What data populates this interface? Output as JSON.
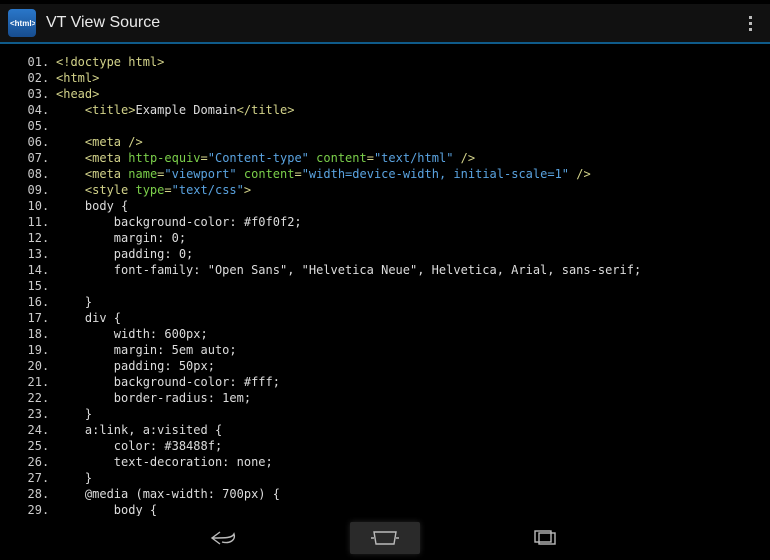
{
  "app": {
    "title": "VT View Source",
    "iconText": "<html>"
  },
  "source": {
    "lines": [
      {
        "n": "01",
        "tokens": [
          {
            "c": "tag",
            "t": "<!doctype html>"
          }
        ]
      },
      {
        "n": "02",
        "tokens": [
          {
            "c": "tag",
            "t": "<html>"
          }
        ]
      },
      {
        "n": "03",
        "tokens": [
          {
            "c": "tag",
            "t": "<head>"
          }
        ]
      },
      {
        "n": "04",
        "tokens": [
          {
            "c": "plain",
            "t": "    "
          },
          {
            "c": "tag",
            "t": "<title>"
          },
          {
            "c": "txt",
            "t": "Example Domain"
          },
          {
            "c": "tag",
            "t": "</title>"
          }
        ]
      },
      {
        "n": "05",
        "tokens": []
      },
      {
        "n": "06",
        "tokens": [
          {
            "c": "plain",
            "t": "    "
          },
          {
            "c": "tag",
            "t": "<meta />"
          }
        ]
      },
      {
        "n": "07",
        "tokens": [
          {
            "c": "plain",
            "t": "    "
          },
          {
            "c": "tag",
            "t": "<meta "
          },
          {
            "c": "attr",
            "t": "http-equiv"
          },
          {
            "c": "tag",
            "t": "="
          },
          {
            "c": "str",
            "t": "\"Content-type\""
          },
          {
            "c": "tag",
            "t": " "
          },
          {
            "c": "attr",
            "t": "content"
          },
          {
            "c": "tag",
            "t": "="
          },
          {
            "c": "str",
            "t": "\"text/html\""
          },
          {
            "c": "tag",
            "t": " />"
          }
        ]
      },
      {
        "n": "08",
        "tokens": [
          {
            "c": "plain",
            "t": "    "
          },
          {
            "c": "tag",
            "t": "<meta "
          },
          {
            "c": "attr",
            "t": "name"
          },
          {
            "c": "tag",
            "t": "="
          },
          {
            "c": "str",
            "t": "\"viewport\""
          },
          {
            "c": "tag",
            "t": " "
          },
          {
            "c": "attr",
            "t": "content"
          },
          {
            "c": "tag",
            "t": "="
          },
          {
            "c": "str",
            "t": "\"width=device-width, initial-scale=1\""
          },
          {
            "c": "tag",
            "t": " />"
          }
        ]
      },
      {
        "n": "09",
        "tokens": [
          {
            "c": "plain",
            "t": "    "
          },
          {
            "c": "tag",
            "t": "<style "
          },
          {
            "c": "attr",
            "t": "type"
          },
          {
            "c": "tag",
            "t": "="
          },
          {
            "c": "str",
            "t": "\"text/css\""
          },
          {
            "c": "tag",
            "t": ">"
          }
        ]
      },
      {
        "n": "10",
        "tokens": [
          {
            "c": "plain",
            "t": "    body {"
          }
        ]
      },
      {
        "n": "11",
        "tokens": [
          {
            "c": "plain",
            "t": "        background-color: #f0f0f2;"
          }
        ]
      },
      {
        "n": "12",
        "tokens": [
          {
            "c": "plain",
            "t": "        margin: 0;"
          }
        ]
      },
      {
        "n": "13",
        "tokens": [
          {
            "c": "plain",
            "t": "        padding: 0;"
          }
        ]
      },
      {
        "n": "14",
        "tokens": [
          {
            "c": "plain",
            "t": "        font-family: \"Open Sans\", \"Helvetica Neue\", Helvetica, Arial, sans-serif;"
          }
        ]
      },
      {
        "n": "15",
        "tokens": []
      },
      {
        "n": "16",
        "tokens": [
          {
            "c": "plain",
            "t": "    }"
          }
        ]
      },
      {
        "n": "17",
        "tokens": [
          {
            "c": "plain",
            "t": "    div {"
          }
        ]
      },
      {
        "n": "18",
        "tokens": [
          {
            "c": "plain",
            "t": "        width: 600px;"
          }
        ]
      },
      {
        "n": "19",
        "tokens": [
          {
            "c": "plain",
            "t": "        margin: 5em auto;"
          }
        ]
      },
      {
        "n": "20",
        "tokens": [
          {
            "c": "plain",
            "t": "        padding: 50px;"
          }
        ]
      },
      {
        "n": "21",
        "tokens": [
          {
            "c": "plain",
            "t": "        background-color: #fff;"
          }
        ]
      },
      {
        "n": "22",
        "tokens": [
          {
            "c": "plain",
            "t": "        border-radius: 1em;"
          }
        ]
      },
      {
        "n": "23",
        "tokens": [
          {
            "c": "plain",
            "t": "    }"
          }
        ]
      },
      {
        "n": "24",
        "tokens": [
          {
            "c": "plain",
            "t": "    a:link, a:visited {"
          }
        ]
      },
      {
        "n": "25",
        "tokens": [
          {
            "c": "plain",
            "t": "        color: #38488f;"
          }
        ]
      },
      {
        "n": "26",
        "tokens": [
          {
            "c": "plain",
            "t": "        text-decoration: none;"
          }
        ]
      },
      {
        "n": "27",
        "tokens": [
          {
            "c": "plain",
            "t": "    }"
          }
        ]
      },
      {
        "n": "28",
        "tokens": [
          {
            "c": "plain",
            "t": "    @media (max-width: 700px) {"
          }
        ]
      },
      {
        "n": "29",
        "tokens": [
          {
            "c": "plain",
            "t": "        body {"
          }
        ]
      }
    ]
  }
}
